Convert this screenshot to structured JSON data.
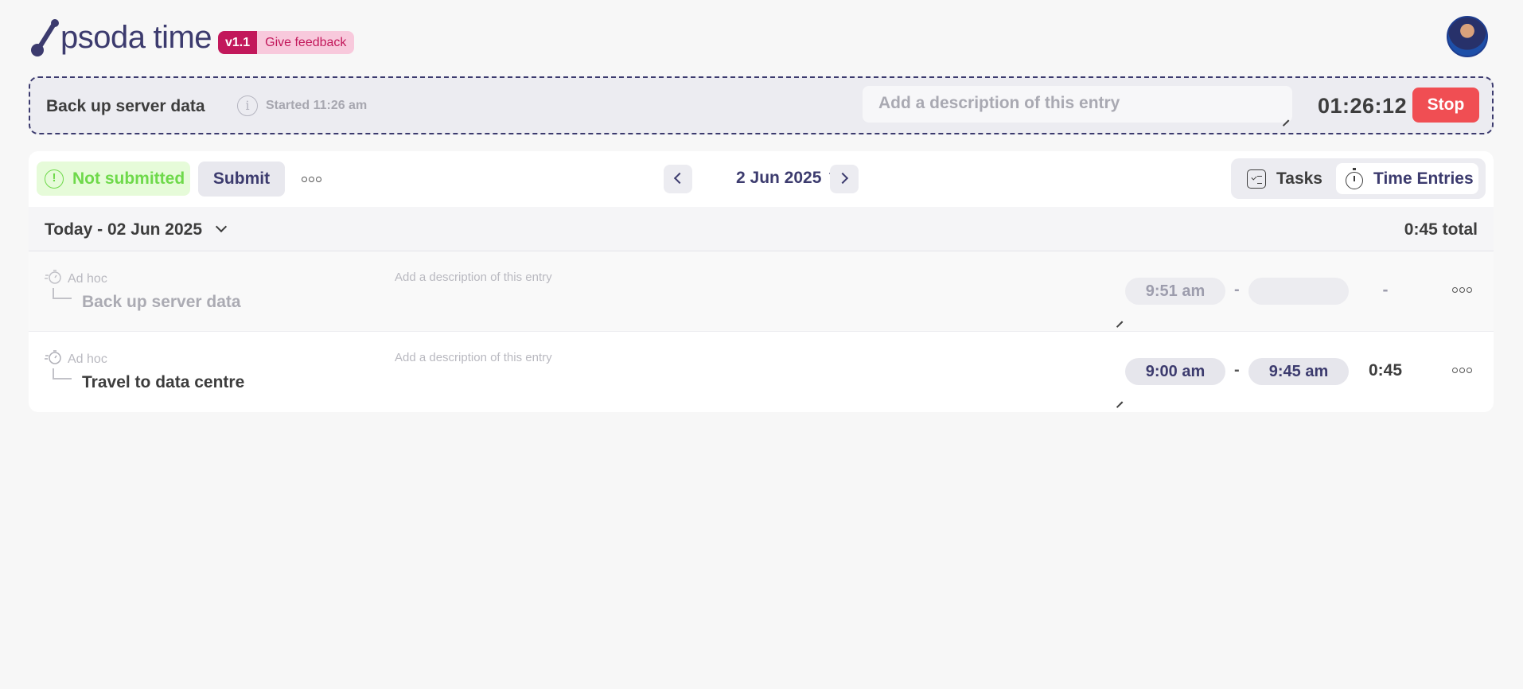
{
  "app": {
    "brand_mark": "psoda",
    "brand_word": "time",
    "version": "v1.1",
    "feedback_label": "Give feedback"
  },
  "timer": {
    "task_name": "Back up server data",
    "started_label": "Started 11:26 am",
    "description_placeholder": "Add a description of this entry",
    "elapsed": "01:26:12",
    "stop_label": "Stop"
  },
  "toolbar": {
    "status_label": "Not submitted",
    "submit_label": "Submit",
    "date_label": "2 Jun 2025",
    "view_tabs": [
      {
        "label": "Tasks",
        "icon": "tasks-icon",
        "active": false
      },
      {
        "label": "Time Entries",
        "icon": "stopwatch-icon",
        "active": true
      }
    ]
  },
  "day": {
    "title": "Today - 02 Jun 2025",
    "total": "0:45 total"
  },
  "entries": [
    {
      "category": "Ad hoc",
      "task_name": "Back up server data",
      "description_placeholder": "Add a description of this entry",
      "start": "9:51 am",
      "end": "",
      "separator": "-",
      "duration": "-",
      "running": true
    },
    {
      "category": "Ad hoc",
      "task_name": "Travel to data centre",
      "description_placeholder": "Add a description of this entry",
      "start": "9:00 am",
      "end": "9:45 am",
      "separator": "-",
      "duration": "0:45",
      "running": false
    }
  ],
  "colors": {
    "brand": "#3c3b6e",
    "accent_pink": "#c2185b",
    "stop_red": "#f04e53",
    "status_green": "#6ed94a"
  }
}
